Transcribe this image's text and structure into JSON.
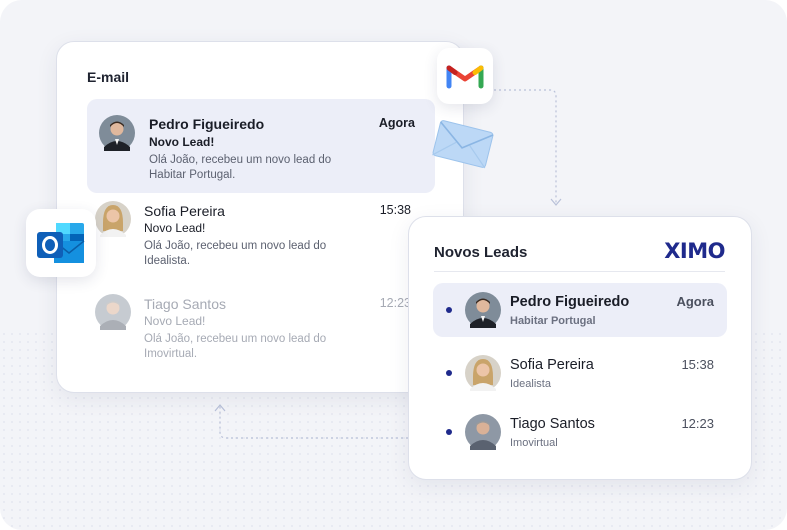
{
  "email_panel": {
    "title": "E-mail",
    "items": [
      {
        "sender": "Pedro Figueiredo",
        "subject": "Novo Lead!",
        "preview": "Olá João, recebeu um novo lead do Habitar Portugal.",
        "time": "Agora"
      },
      {
        "sender": "Sofia Pereira",
        "subject": "Novo Lead!",
        "preview": "Olá João, recebeu um novo lead do Idealista.",
        "time": "15:38"
      },
      {
        "sender": "Tiago Santos",
        "subject": "Novo Lead!",
        "preview": "Olá João, recebeu um novo lead do Imovirtual.",
        "time": "12:23"
      }
    ]
  },
  "leads_panel": {
    "title": "Novos Leads",
    "brand": "XIMO",
    "items": [
      {
        "name": "Pedro Figueiredo",
        "source": "Habitar Portugal",
        "time": "Agora"
      },
      {
        "name": "Sofia Pereira",
        "source": "Idealista",
        "time": "15:38"
      },
      {
        "name": "Tiago Santos",
        "source": "Imovirtual",
        "time": "12:23"
      }
    ]
  },
  "icons": {
    "gmail": "gmail-icon",
    "outlook": "outlook-icon",
    "envelope": "envelope-icon",
    "unread_dot": "unread-dot-icon"
  },
  "colors": {
    "brand": "#1f2a8c",
    "active_row": "#eceef8",
    "background": "#f3f4f8"
  }
}
